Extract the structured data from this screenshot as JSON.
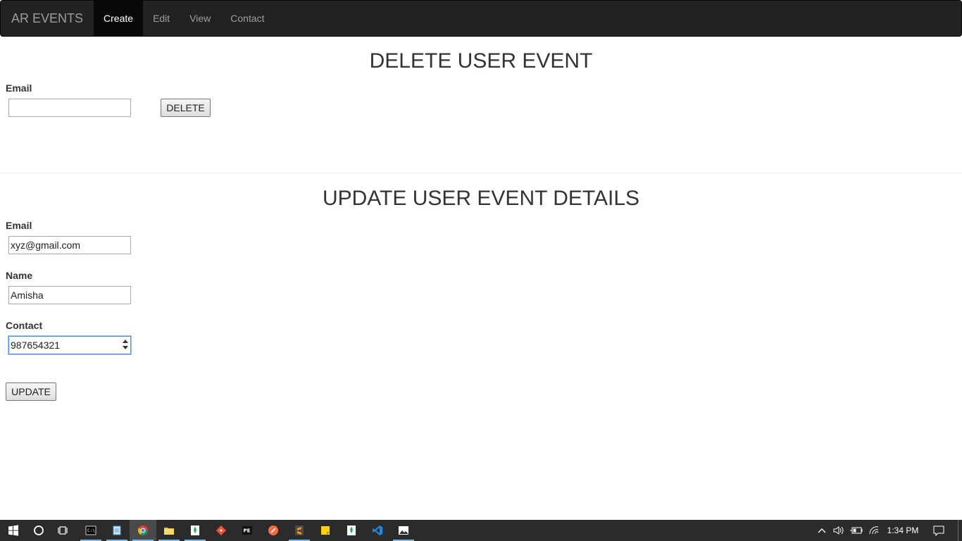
{
  "navbar": {
    "brand": "AR EVENTS",
    "items": [
      {
        "label": "Create",
        "active": true
      },
      {
        "label": "Edit",
        "active": false
      },
      {
        "label": "View",
        "active": false
      },
      {
        "label": "Contact",
        "active": false
      }
    ]
  },
  "delete_section": {
    "title": "DELETE USER EVENT",
    "email_label": "Email",
    "email_value": "",
    "delete_button": "DELETE"
  },
  "update_section": {
    "title": "UPDATE USER EVENT DETAILS",
    "email_label": "Email",
    "email_value": "xyz@gmail.com",
    "name_label": "Name",
    "name_value": "Amisha",
    "contact_label": "Contact",
    "contact_value": "987654321",
    "update_button": "UPDATE"
  },
  "taskbar": {
    "clock": "1:34 PM",
    "apps": [
      "start-icon",
      "cortana-icon",
      "task-view-icon",
      "cmd-icon",
      "notepad-icon",
      "chrome-icon",
      "file-explorer-icon",
      "mongodb-icon",
      "git-icon",
      "pe-icon",
      "sublime-merge-icon",
      "sublime-text-icon",
      "sticky-notes-icon",
      "mongodb-compass-icon",
      "vscode-icon",
      "photos-icon"
    ]
  },
  "colors": {
    "navbar_bg": "#222222",
    "navbar_active_bg": "#080808",
    "nav_text": "#9d9d9d",
    "focus_border": "#4d90fe",
    "taskbar_bg": "#2b2b2b",
    "taskbar_accent": "#76b9ed"
  }
}
